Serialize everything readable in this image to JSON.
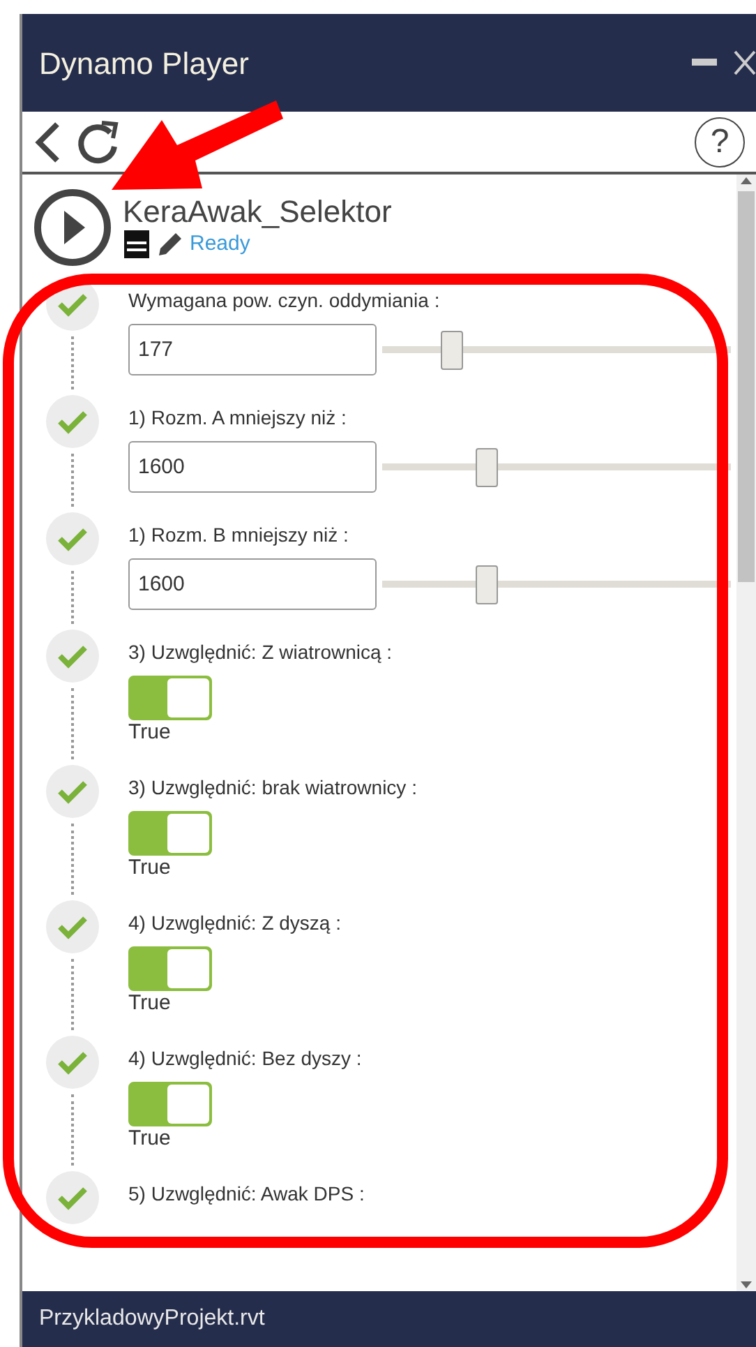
{
  "window": {
    "title": "Dynamo Player"
  },
  "script": {
    "name": "KeraAwak_Selektor",
    "status": "Ready"
  },
  "inputs": [
    {
      "kind": "number",
      "label": "Wymagana pow. czyn. oddymiania :",
      "value": "177",
      "level": 0.2,
      "done": true
    },
    {
      "kind": "number",
      "label": "1) Rozm. A mniejszy niż :",
      "value": "1600",
      "level": 0.3,
      "done": true
    },
    {
      "kind": "number",
      "label": "1) Rozm. B mniejszy niż :",
      "value": "1600",
      "level": 0.3,
      "done": true
    },
    {
      "kind": "toggle",
      "label": "3) Uzwględnić: Z wiatrownicą :",
      "on": true,
      "value": "True",
      "done": true
    },
    {
      "kind": "toggle",
      "label": "3) Uzwględnić: brak wiatrownicy :",
      "on": true,
      "value": "True",
      "done": true
    },
    {
      "kind": "toggle",
      "label": "4) Uzwględnić: Z dyszą :",
      "on": true,
      "value": "True",
      "done": true
    },
    {
      "kind": "toggle",
      "label": "4) Uzwględnić: Bez dyszy :",
      "on": true,
      "value": "True",
      "done": true
    },
    {
      "kind": "cut",
      "label": "5) Uzwględnić: Awak DPS :",
      "done": true
    }
  ],
  "status_bar": {
    "file": "PrzykladowyProjekt.rvt"
  },
  "toolbar": {
    "help": "?"
  },
  "annotations": {
    "highlight_frame": true,
    "pointer_arrow": true
  }
}
